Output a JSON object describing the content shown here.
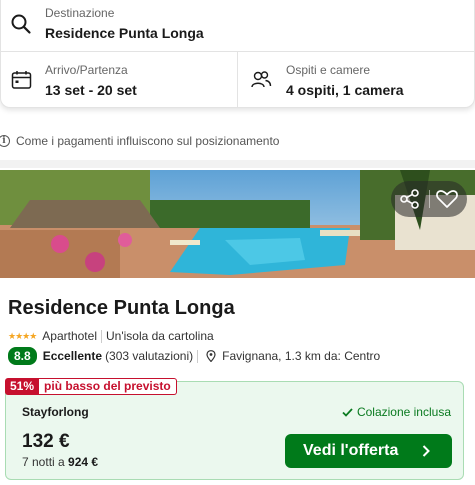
{
  "search": {
    "destination_label": "Destinazione",
    "destination_value": "Residence Punta Longa",
    "dates_label": "Arrivo/Partenza",
    "dates_value": "13 set - 20 set",
    "guests_label": "Ospiti e camere",
    "guests_value": "4 ospiti, 1 camera"
  },
  "payment_info": "Come i pagamenti influiscono sul posizionamento",
  "hotel": {
    "name": "Residence Punta Longa",
    "stars": "★★★★",
    "type": "Aparthotel",
    "tagline": "Un'isola da cartolina",
    "rating_score": "8.8",
    "rating_word": "Eccellente",
    "rating_count": "(303 valutazioni)",
    "location": "Favignana, 1.3 km da: Centro"
  },
  "offer": {
    "deal_percent": "51%",
    "deal_text": "più basso del previsto",
    "provider": "Stayforlong",
    "perk": "Colazione inclusa",
    "price": "132 €",
    "nights_prefix": "7 notti a",
    "total": "924 €",
    "cta_label": "Vedi l'offerta"
  },
  "icons": [
    "search-icon",
    "calendar-icon",
    "guests-icon",
    "info-icon",
    "share-icon",
    "heart-icon",
    "pin-icon",
    "check-icon",
    "chevron-right-icon"
  ],
  "colors": {
    "accent_green": "#007a1a",
    "deal_red": "#c6102e",
    "star_gold": "#f5a623",
    "offer_bg": "#ebf8ee"
  }
}
